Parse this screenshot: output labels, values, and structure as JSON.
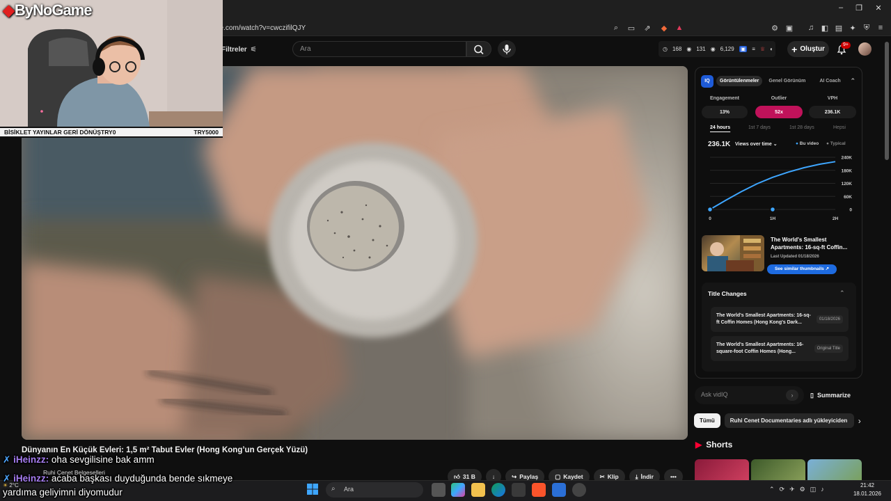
{
  "browser": {
    "url": "be.com/watch?v=cwczifilQJY"
  },
  "youtube": {
    "filter_label": "Filtreler",
    "search_placeholder": "Ara",
    "stats": {
      "likes": "168",
      "views_a": "131",
      "views_b": "6,129"
    },
    "create_label": "Oluştur",
    "notif_badge": "9+"
  },
  "video": {
    "title": "Dünyanın En Küçük Evleri: 1,5 m² Tabut Evler (Hong Kong’un Gerçek Yüzü)",
    "channel": "Ruhi Çenet Belgeselleri",
    "actions": {
      "likes": "31 B",
      "share": "Paylaş",
      "save": "Kaydet",
      "clip": "Klip",
      "download": "İndir"
    }
  },
  "vidiq": {
    "logo": "IQ",
    "tabs": [
      "Görüntülenmeler",
      "Genel Görünüm",
      "AI Coach"
    ],
    "metrics": [
      {
        "label": "Engagement",
        "value": "13%"
      },
      {
        "label": "Outlier",
        "value": "52x"
      },
      {
        "label": "VPH",
        "value": "236.1K"
      }
    ],
    "ranges": [
      "24 hours",
      "1st 7 days",
      "1st 28 days",
      "Hepsi"
    ],
    "chart": {
      "value": "236.1K",
      "mode": "Views over time",
      "legend_this": "Bu video",
      "legend_typical": "Typical"
    },
    "video_card": {
      "title": "The World's Smallest Apartments: 16-sq-ft Coffin...",
      "updated": "Last Updated 01/18/2026",
      "similar": "See similar thumbnails"
    },
    "title_changes": {
      "heading": "Title Changes",
      "items": [
        {
          "title": "The World's Smallest Apartments: 16-sq-ft Coffin Homes (Hong Kong's Dark...",
          "date": "01/18/2026"
        },
        {
          "title": "The World's Smallest Apartments: 16-square-foot Coffin Homes (Hong...",
          "date": "Original Title"
        }
      ]
    },
    "ask_placeholder": "Ask vidIQ",
    "summarize": "Summarize"
  },
  "chart_data": {
    "type": "line",
    "x_ticks": [
      "0",
      "1H",
      "2H"
    ],
    "y_ticks": [
      "240K",
      "180K",
      "120K",
      "60K",
      "0"
    ],
    "ylim": [
      0,
      240000
    ],
    "xlim": [
      0,
      2
    ],
    "series": [
      {
        "name": "Bu video",
        "x": [
          0,
          0.25,
          0.5,
          0.75,
          1,
          1.25,
          1.5,
          1.75,
          2
        ],
        "y": [
          0,
          42000,
          82000,
          118000,
          148000,
          172000,
          192000,
          208000,
          220000
        ]
      }
    ]
  },
  "sidebar": {
    "chips": [
      "Tümü",
      "Ruhi Cenet Documentaries adlı yükleyiciden"
    ],
    "shorts_heading": "Shorts"
  },
  "stream": {
    "logo": "ByNoGame",
    "banner_left": "BİSİKLET YAYINLAR GERİ DÖNÜŞTRY0",
    "banner_right": "TRY5000"
  },
  "chat": [
    {
      "user": "iHeinzz:",
      "message": "oha sevgilisine bak amm"
    },
    {
      "user": "iHeinzz:",
      "message": "acaba başkası duyduğunda bende sıkmeye"
    },
    {
      "user": "",
      "message": "yardıma geliyimni diyomudur"
    }
  ],
  "taskbar": {
    "search": "Ara",
    "time": "21:42",
    "date": "18.01.2026",
    "weather": "2°C"
  }
}
